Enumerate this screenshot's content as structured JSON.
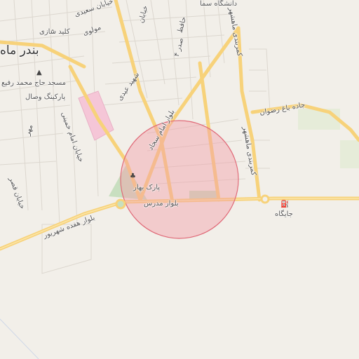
{
  "map": {
    "colors": {
      "background": "#f2efe9",
      "road_major": "#f7d27a",
      "road_minor": "#ffffff",
      "park": "#c8dfc0",
      "building": "#f5c6d7",
      "circle_fill": "#f2a0a8",
      "circle_stroke": "#e06a78"
    },
    "labels": {
      "city": "بندر ماه",
      "university": "دانشگاه سما",
      "street_saeedi": "خیابان سعیدی",
      "street_molavi": "مولوی",
      "street_hafez": "حافظ",
      "street_sadr": "صدر ۴",
      "street_khayyam": "خیابان",
      "key_saz": "کلید سازی",
      "mosque": "مسجد حاج محمد رفیع",
      "parking": "پارکینگ وصال",
      "shahid_eidi": "شهید عیدی",
      "mehr": "مهر",
      "imam_khomeini": "خیابان امام خمینی",
      "ghaleh": "خیابان قصر",
      "imam_soldier": "بلوار امام سجاد",
      "bahar_park": "پارک بهار",
      "modares": "بلوار مدرس",
      "hefdah_shahrivar": "بلوار هفده شهریور",
      "kamarbandi_1": "کمربندی ماهشهر",
      "kamarbandi_2": "کمربندی ماهشهر",
      "kamarbandi_3": "کمربندی ماهشهر",
      "bagh_rezvan": "جاده باغ رضوان",
      "jaygah": "جایگاه",
      "mahshahr_short": "ماهشهر"
    },
    "icons": [
      "shop-icon",
      "mosque-icon",
      "tree-icon",
      "fuel-icon"
    ]
  }
}
